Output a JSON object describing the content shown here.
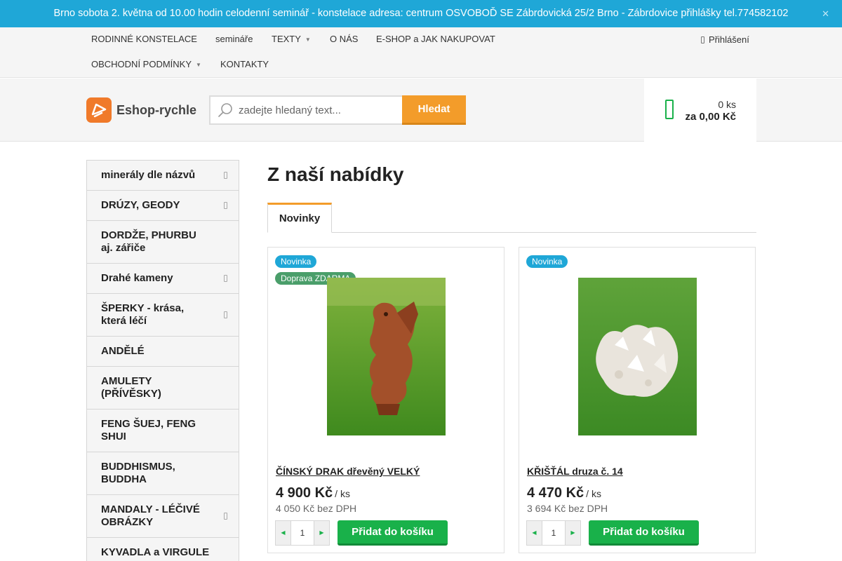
{
  "topbar": {
    "message": "Brno sobota 2. května od 10.00 hodin celodenní seminář -  konstelace adresa: centrum OSVOBOĎ SE Zábrdovická 25/2 Brno - Zábrdovice přihlášky tel.774582102",
    "close_icon": "close-icon"
  },
  "nav": {
    "items": [
      {
        "label": "RODINNÉ KONSTELACE"
      },
      {
        "label": "semináře"
      },
      {
        "label": "TEXTY",
        "has_dropdown": true
      },
      {
        "label": "O NÁS"
      },
      {
        "label": "E-SHOP a JAK NAKUPOVAT"
      },
      {
        "label": "OBCHODNÍ PODMÍNKY",
        "has_dropdown": true
      },
      {
        "label": "KONTAKTY"
      }
    ],
    "login_label": "Přihlášení"
  },
  "header": {
    "logo_text": "Eshop-rychle",
    "search_placeholder": "zadejte hledaný text...",
    "search_button": "Hledat",
    "cart_count": "0 ks",
    "cart_total": "za 0,00 Kč"
  },
  "sidebar": {
    "categories": [
      {
        "label": "minerály dle názvů",
        "has_submenu": true
      },
      {
        "label": "DRÚZY, GEODY",
        "has_submenu": true
      },
      {
        "label": "DORDŽE, PHURBU aj. zářiče",
        "has_submenu": false
      },
      {
        "label": "Drahé kameny",
        "has_submenu": true
      },
      {
        "label": "ŠPERKY - krása, která léčí",
        "has_submenu": true
      },
      {
        "label": "ANDĚLÉ",
        "has_submenu": false
      },
      {
        "label": "AMULETY (PŘÍVĚSKY)",
        "has_submenu": false
      },
      {
        "label": "FENG ŠUEJ, FENG SHUI",
        "has_submenu": false
      },
      {
        "label": "BUDDHISMUS, BUDDHA",
        "has_submenu": false
      },
      {
        "label": "MANDALY - LÉČIVÉ OBRÁZKY",
        "has_submenu": true
      },
      {
        "label": "KYVADLA a VIRGULE",
        "has_submenu": false
      }
    ]
  },
  "main": {
    "title": "Z naší nabídky",
    "tab_label": "Novinky"
  },
  "products": [
    {
      "badges": [
        "Novinka",
        "Doprava ZDARMA"
      ],
      "name": "ČÍNSKÝ DRAK dřevěný VELKÝ",
      "price": "4 900 Kč",
      "unit": "/ ks",
      "price_net": "4 050 Kč bez DPH",
      "qty": "1",
      "add_label": "Přidat do košíku"
    },
    {
      "badges": [
        "Novinka"
      ],
      "name": "KŘIŠŤÁL druza č. 14",
      "price": "4 470 Kč",
      "unit": "/ ks",
      "price_net": "3 694 Kč bez DPH",
      "qty": "1",
      "add_label": "Přidat do košíku"
    }
  ],
  "colors": {
    "accent_blue": "#1fa7d7",
    "accent_orange": "#f39c2a",
    "accent_green": "#19b14a"
  }
}
